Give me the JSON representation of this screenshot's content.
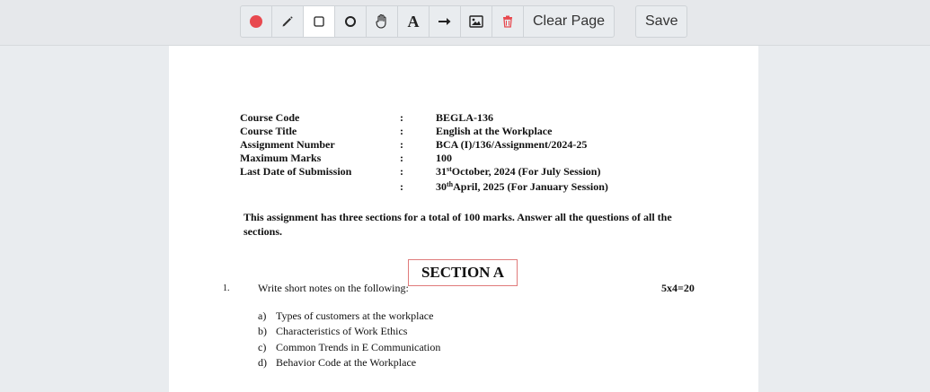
{
  "toolbar": {
    "tools": [
      {
        "name": "record-dot-icon",
        "color": "#e8494f"
      },
      {
        "name": "pencil-icon"
      },
      {
        "name": "rectangle-icon"
      },
      {
        "name": "circle-icon"
      },
      {
        "name": "hand-pan-icon"
      },
      {
        "name": "text-icon",
        "glyph": "A"
      },
      {
        "name": "arrow-icon"
      },
      {
        "name": "image-icon"
      },
      {
        "name": "trash-icon",
        "color": "#e8494f"
      }
    ],
    "clear_label": "Clear Page",
    "save_label": "Save"
  },
  "document": {
    "meta": [
      {
        "key": "Course Code",
        "sep": ":",
        "value": "BEGLA-136"
      },
      {
        "key": "Course Title",
        "sep": ":",
        "value": "English at the Workplace"
      },
      {
        "key": "Assignment Number",
        "sep": ":",
        "value": "BCA (I)/136/Assignment/2024-25"
      },
      {
        "key": "Maximum Marks",
        "sep": ":",
        "value": "100"
      },
      {
        "key": "Last Date of Submission",
        "sep": ":",
        "value_day": "31",
        "value_sup": "st",
        "value_rest": "October, 2024 (For July Session)"
      },
      {
        "key": "",
        "sep": ":",
        "value_day": "30",
        "value_sup": "th",
        "value_rest": "April, 2025 (For January Session)"
      }
    ],
    "intro": "This assignment has three sections for a total of 100 marks. Answer all the questions of all the sections.",
    "section_title": "SECTION A",
    "question": {
      "number": "1.",
      "text": "Write short notes on the following:",
      "marks": "5x4=20",
      "items": [
        {
          "letter": "a)",
          "text": "Types of customers at the workplace"
        },
        {
          "letter": "b)",
          "text": "Characteristics of Work Ethics"
        },
        {
          "letter": "c)",
          "text": "Common Trends in E Communication"
        },
        {
          "letter": "d)",
          "text": "Behavior Code at the Workplace"
        }
      ]
    }
  },
  "colors": {
    "accent_red": "#e8494f",
    "section_box_border": "#e07b7b",
    "toolbar_bg": "#e6e8eb"
  }
}
